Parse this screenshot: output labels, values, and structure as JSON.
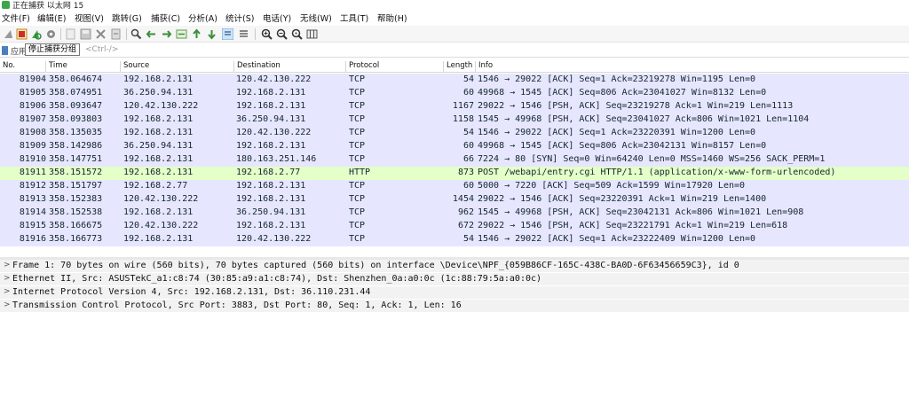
{
  "window": {
    "title": "正在捕获 以太网 15"
  },
  "menu": [
    "文件(F)",
    "编辑(E)",
    "视图(V)",
    "跳转(G)",
    "捕获(C)",
    "分析(A)",
    "统计(S)",
    "电话(Y)",
    "无线(W)",
    "工具(T)",
    "帮助(H)"
  ],
  "toolbar": {
    "tooltip": "停止捕获分组",
    "icons": [
      "shark-fin-icon",
      "stop-capture-icon",
      "restart-capture-icon",
      "capture-options-icon",
      "open-file-icon",
      "save-file-icon",
      "close-file-icon",
      "reload-icon",
      "find-packet-icon",
      "go-back-icon",
      "go-forward-icon",
      "go-to-packet-icon",
      "first-packet-icon",
      "last-packet-icon",
      "autoscroll-icon",
      "colorize-icon",
      "zoom-in-icon",
      "zoom-out-icon",
      "normal-size-icon",
      "resize-columns-icon"
    ]
  },
  "filter": {
    "prefix": "应用",
    "placeholder": "<Ctrl-/>"
  },
  "columns": [
    "No.",
    "Time",
    "Source",
    "Destination",
    "Protocol",
    "Length",
    "Info"
  ],
  "packets": [
    [
      "81904",
      "358.064674",
      "192.168.2.131",
      "120.42.130.222",
      "TCP",
      "54",
      "1546 → 29022 [ACK] Seq=1 Ack=23219278 Win=1195 Len=0"
    ],
    [
      "81905",
      "358.074951",
      "36.250.94.131",
      "192.168.2.131",
      "TCP",
      "60",
      "49968 → 1545 [ACK] Seq=806 Ack=23041027 Win=8132 Len=0"
    ],
    [
      "81906",
      "358.093647",
      "120.42.130.222",
      "192.168.2.131",
      "TCP",
      "1167",
      "29022 → 1546 [PSH, ACK] Seq=23219278 Ack=1 Win=219 Len=1113"
    ],
    [
      "81907",
      "358.093803",
      "192.168.2.131",
      "36.250.94.131",
      "TCP",
      "1158",
      "1545 → 49968 [PSH, ACK] Seq=23041027 Ack=806 Win=1021 Len=1104"
    ],
    [
      "81908",
      "358.135035",
      "192.168.2.131",
      "120.42.130.222",
      "TCP",
      "54",
      "1546 → 29022 [ACK] Seq=1 Ack=23220391 Win=1200 Len=0"
    ],
    [
      "81909",
      "358.142986",
      "36.250.94.131",
      "192.168.2.131",
      "TCP",
      "60",
      "49968 → 1545 [ACK] Seq=806 Ack=23042131 Win=8157 Len=0"
    ],
    [
      "81910",
      "358.147751",
      "192.168.2.131",
      "180.163.251.146",
      "TCP",
      "66",
      "7224 → 80 [SYN] Seq=0 Win=64240 Len=0 MSS=1460 WS=256 SACK_PERM=1"
    ],
    [
      "81911",
      "358.151572",
      "192.168.2.131",
      "192.168.2.77",
      "HTTP",
      "873",
      "POST /webapi/entry.cgi HTTP/1.1  (application/x-www-form-urlencoded)"
    ],
    [
      "81912",
      "358.151797",
      "192.168.2.77",
      "192.168.2.131",
      "TCP",
      "60",
      "5000 → 7220 [ACK] Seq=509 Ack=1599 Win=17920 Len=0"
    ],
    [
      "81913",
      "358.152383",
      "120.42.130.222",
      "192.168.2.131",
      "TCP",
      "1454",
      "29022 → 1546 [ACK] Seq=23220391 Ack=1 Win=219 Len=1400"
    ],
    [
      "81914",
      "358.152538",
      "192.168.2.131",
      "36.250.94.131",
      "TCP",
      "962",
      "1545 → 49968 [PSH, ACK] Seq=23042131 Ack=806 Win=1021 Len=908"
    ],
    [
      "81915",
      "358.166675",
      "120.42.130.222",
      "192.168.2.131",
      "TCP",
      "672",
      "29022 → 1546 [PSH, ACK] Seq=23221791 Ack=1 Win=219 Len=618"
    ],
    [
      "81916",
      "358.166773",
      "192.168.2.131",
      "120.42.130.222",
      "TCP",
      "54",
      "1546 → 29022 [ACK] Seq=1 Ack=23222409 Win=1200 Len=0"
    ]
  ],
  "details": [
    "Frame 1: 70 bytes on wire (560 bits), 70 bytes captured (560 bits) on interface \\Device\\NPF_{059B86CF-165C-438C-BA0D-6F63456659C3}, id 0",
    "Ethernet II, Src: ASUSTekC_a1:c8:74 (30:85:a9:a1:c8:74), Dst: Shenzhen_0a:a0:0c (1c:88:79:5a:a0:0c)",
    "Internet Protocol Version 4, Src: 192.168.2.131, Dst: 36.110.231.44",
    "Transmission Control Protocol, Src Port: 3883, Dst Port: 80, Seq: 1, Ack: 1, Len: 16"
  ],
  "colors": {
    "tcp_row": "#e7e6ff",
    "http_row": "#e4ffc7",
    "detail_row": "#f2f2f2",
    "stop_button": "#d22b2b",
    "restart_button": "#3aa84a"
  }
}
